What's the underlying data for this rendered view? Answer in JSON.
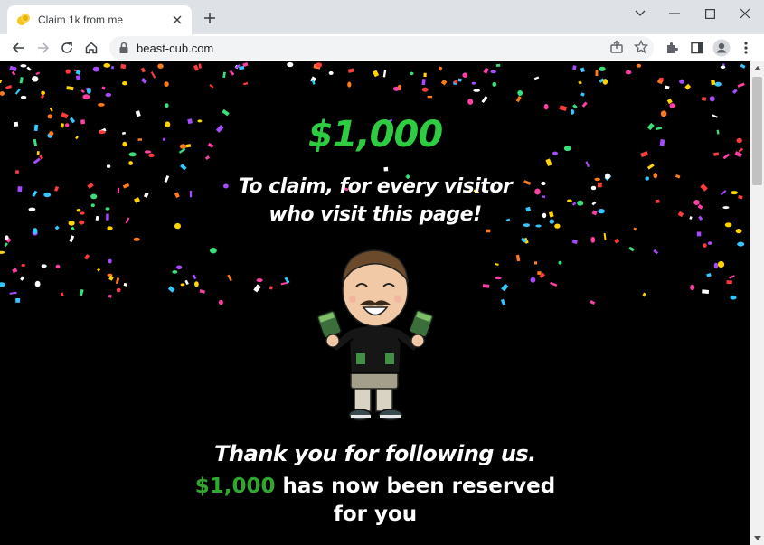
{
  "browser": {
    "tab_title": "Claim 1k from me",
    "url": "beast-cub.com"
  },
  "page": {
    "amount": "$1,000",
    "subtitle_line1": "To claim, for every visitor",
    "subtitle_line2": "who visit this page!",
    "thanks": "Thank you for following us.",
    "reserved_amount": "$1,000",
    "reserved_text": " has now been reserved",
    "reserved_line2": "for you"
  },
  "colors": {
    "amount_green": "#2ecc40",
    "reserved_green": "#2ea82e",
    "background": "#000000",
    "confetti": [
      "#ff3fa4",
      "#ffd400",
      "#35c6ff",
      "#a64bff",
      "#ff7a1a",
      "#37e07a",
      "#ff3b3b",
      "#ffffff"
    ]
  },
  "icons": [
    "favicon-icon",
    "close-icon",
    "plus-icon",
    "minimize-icon",
    "maximize-icon",
    "close-window-icon",
    "back-arrow-icon",
    "forward-arrow-icon",
    "reload-icon",
    "home-icon",
    "lock-icon",
    "share-icon",
    "star-icon",
    "extensions-icon",
    "sidepanel-icon",
    "profile-icon",
    "menu-icon"
  ]
}
